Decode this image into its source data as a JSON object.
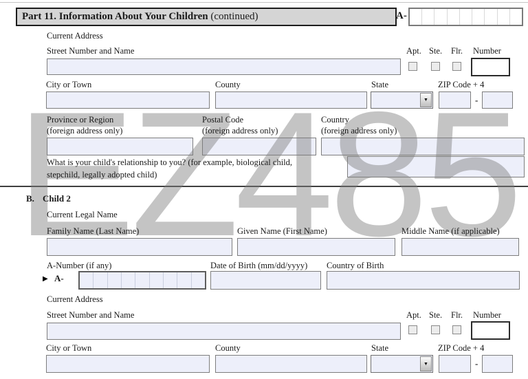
{
  "watermark": "EZ485",
  "header": {
    "title_bold": "Part 11.  Information About Your Children",
    "continued": " (continued)",
    "a_prefix": "A-"
  },
  "child1": {
    "current_address": "Current Address",
    "street": "Street Number and Name",
    "apt": "Apt.",
    "ste": "Ste.",
    "flr": "Flr.",
    "number": "Number",
    "city": "City or Town",
    "county": "County",
    "state": "State",
    "zip": "ZIP Code + 4",
    "zip_dash": "-",
    "province": "Province or Region",
    "province_note": "(foreign address only)",
    "postal": "Postal Code",
    "postal_note": "(foreign address only)",
    "country": "Country",
    "country_note": "(foreign address only)",
    "relationship_line1": "What is your child's relationship to you? (for example, biological child,",
    "relationship_line2": "stepchild, legally adopted child)"
  },
  "child2": {
    "letter": "B.",
    "heading": "Child 2",
    "legal_name": "Current Legal Name",
    "family": "Family Name (Last Name)",
    "given": "Given Name (First Name)",
    "middle": "Middle Name (if applicable)",
    "a_number": "A-Number (if any)",
    "arrow": "▶",
    "a_prefix": "A-",
    "dob": "Date of Birth (mm/dd/yyyy)",
    "country_of_birth": "Country of Birth",
    "current_address": "Current Address",
    "street": "Street Number and Name",
    "apt": "Apt.",
    "ste": "Ste.",
    "flr": "Flr.",
    "number": "Number",
    "city": "City or Town",
    "county": "County",
    "state": "State",
    "zip": "ZIP Code + 4",
    "zip_dash": "-"
  },
  "colors": {
    "input_fill": "#edeffa",
    "header_fill": "#d5d5d5",
    "watermark_gray": "#7e7e7e"
  }
}
